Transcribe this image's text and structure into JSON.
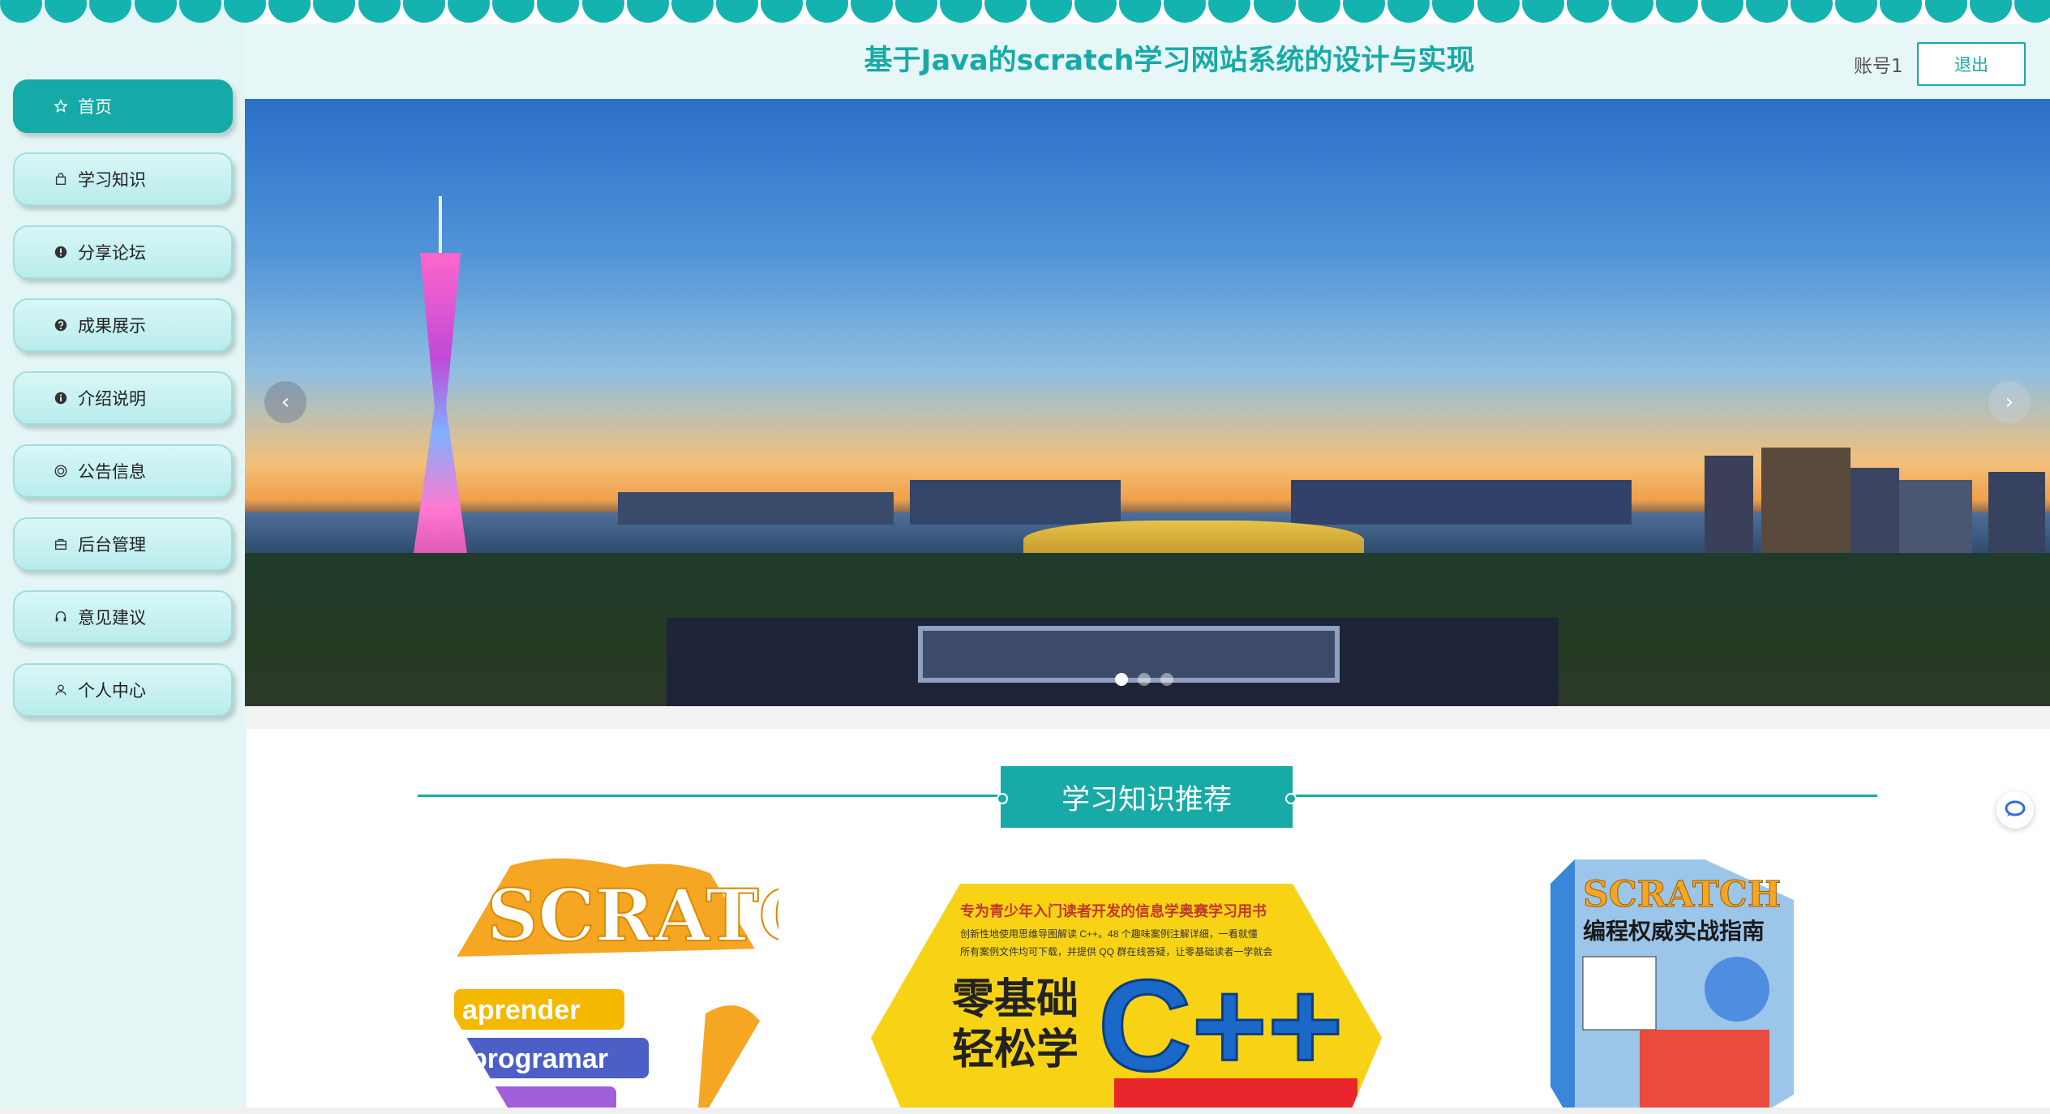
{
  "header": {
    "title": "基于Java的scratch学习网站系统的设计与实现",
    "account": "账号1",
    "logout_label": "退出"
  },
  "sidebar": {
    "items": [
      {
        "label": "首页",
        "icon": "star-icon",
        "active": true
      },
      {
        "label": "学习知识",
        "icon": "bag-icon",
        "active": false
      },
      {
        "label": "分享论坛",
        "icon": "alert-circle-icon",
        "active": false
      },
      {
        "label": "成果展示",
        "icon": "question-circle-icon",
        "active": false
      },
      {
        "label": "介绍说明",
        "icon": "info-circle-icon",
        "active": false
      },
      {
        "label": "公告信息",
        "icon": "target-icon",
        "active": false
      },
      {
        "label": "后台管理",
        "icon": "briefcase-icon",
        "active": false
      },
      {
        "label": "意见建议",
        "icon": "headset-icon",
        "active": false
      },
      {
        "label": "个人中心",
        "icon": "user-icon",
        "active": false
      }
    ]
  },
  "banner": {
    "slide_count": 3,
    "active_slide": 1,
    "prev_label": "‹",
    "next_label": "›"
  },
  "section": {
    "title": "学习知识推荐"
  },
  "cards": [
    {
      "text": "SCRATCH",
      "subtitle_1": "aprender",
      "subtitle_2": "programar"
    },
    {
      "headline": "专为青少年入门读者开发的信息学奥赛学习用书",
      "line_1": "创新性地使用思维导图解读 C++。48 个趣味案例注解详细，一看就懂",
      "line_2": "所有案例文件均可下载，并提供 QQ 群在线答疑，让零基础读者一学就会",
      "title_1": "零基础",
      "title_2": "轻松学",
      "big": "C++"
    },
    {
      "text": "SCRATCH",
      "subtitle": "编程权威实战指南"
    }
  ],
  "colors": {
    "accent": "#17aaa7",
    "sidebar_bg": "#e3f5f5"
  }
}
